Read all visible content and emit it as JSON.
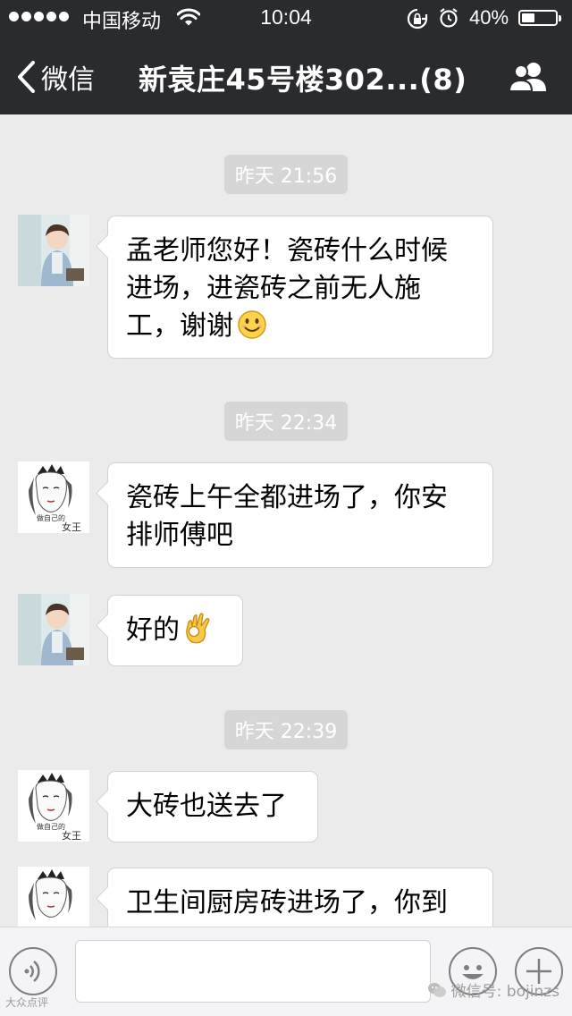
{
  "status_bar": {
    "carrier": "中国移动",
    "time": "10:04",
    "battery_percent": "40%",
    "battery_level": 0.4,
    "signal_dots": 5
  },
  "nav": {
    "back_label": "微信",
    "title": "新袁庄45号楼302...(8)"
  },
  "messages": [
    {
      "type": "time",
      "text": "昨天 21:56"
    },
    {
      "type": "msg",
      "sender": "child-avatar",
      "lines": [
        "孟老师您好！瓷砖什么时候",
        "进场，进瓷砖之前无人施",
        "工，谢谢"
      ],
      "emoji": "smile-emoji"
    },
    {
      "type": "time",
      "text": "昨天 22:34"
    },
    {
      "type": "msg",
      "sender": "queen-avatar",
      "lines": [
        "瓷砖上午全都进场了，你安",
        "排师傅吧"
      ]
    },
    {
      "type": "msg",
      "sender": "child-avatar",
      "lines": [
        "好的"
      ],
      "emoji": "ok-hand-emoji"
    },
    {
      "type": "time",
      "text": "昨天 22:39"
    },
    {
      "type": "msg",
      "sender": "queen-avatar",
      "lines": [
        "大砖也送去了"
      ]
    },
    {
      "type": "msg",
      "sender": "queen-avatar",
      "lines": [
        "卫生间厨房砖进场了，你到"
      ]
    }
  ],
  "avatar_queen": {
    "top_text": "做自己的",
    "big_text": "女王"
  },
  "input_bar": {
    "input_placeholder": "",
    "icons": [
      "voice-icon",
      "emoji-icon",
      "plus-icon"
    ]
  },
  "watermark": {
    "right": "微信号: bojinzs",
    "left": "大众点评"
  },
  "colors": {
    "nav_bg": "#2a2b2f",
    "chat_bg": "#ebebeb",
    "time_pill": "#d6d6d6"
  }
}
